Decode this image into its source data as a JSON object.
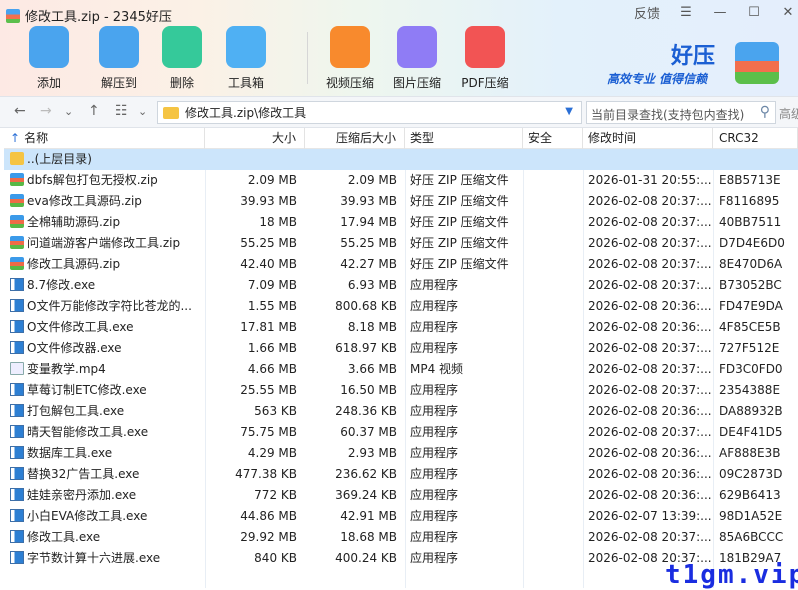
{
  "window": {
    "title": "修改工具.zip - 2345好压",
    "feedback": "反馈",
    "menu_icon": "menu-icon",
    "minimize_icon": "minimize-icon",
    "maximize_icon": "maximize-icon",
    "close_icon": "close-icon"
  },
  "toolbar": [
    {
      "label": "添加",
      "icon": "add-archive-icon",
      "color": "#4aa4ee"
    },
    {
      "label": "解压到",
      "icon": "extract-icon",
      "color": "#4aa4ee"
    },
    {
      "label": "删除",
      "icon": "recycle-icon",
      "color": "#35c99a"
    },
    {
      "label": "工具箱",
      "icon": "toolbox-icon",
      "color": "#4fb0f3"
    },
    {
      "label": "视频压缩",
      "icon": "video-compress-icon",
      "color": "#f88a2d"
    },
    {
      "label": "图片压缩",
      "icon": "image-compress-icon",
      "color": "#8f7cf5"
    },
    {
      "label": "PDF压缩",
      "icon": "pdf-compress-icon",
      "color": "#f25454"
    }
  ],
  "brand": {
    "name": "好压",
    "slogan": "高效专业 值得信赖"
  },
  "nav": {
    "path": "修改工具.zip\\修改工具",
    "search_placeholder": "当前目录查找(支持包内查找)",
    "advanced": "高级"
  },
  "columns": [
    "名称",
    "大小",
    "压缩后大小",
    "类型",
    "安全",
    "修改时间",
    "CRC32"
  ],
  "parent": "..(上层目录)",
  "files": [
    [
      "zip",
      "dbfs解包打包无授权.zip",
      "2.09 MB",
      "2.09 MB",
      "好压 ZIP 压缩文件",
      "",
      "2026-01-31 20:55:...",
      "E8B5713E"
    ],
    [
      "zip",
      "eva修改工具源码.zip",
      "39.93 MB",
      "39.93 MB",
      "好压 ZIP 压缩文件",
      "",
      "2026-02-08 20:37:...",
      "F8116895"
    ],
    [
      "zip",
      "全棉辅助源码.zip",
      "18 MB",
      "17.94 MB",
      "好压 ZIP 压缩文件",
      "",
      "2026-02-08 20:37:...",
      "40BB7511"
    ],
    [
      "zip",
      "问道端游客户端修改工具.zip",
      "55.25 MB",
      "55.25 MB",
      "好压 ZIP 压缩文件",
      "",
      "2026-02-08 20:37:...",
      "D7D4E6D0"
    ],
    [
      "zip",
      "修改工具源码.zip",
      "42.40 MB",
      "42.27 MB",
      "好压 ZIP 压缩文件",
      "",
      "2026-02-08 20:37:...",
      "8E470D6A"
    ],
    [
      "exe",
      "8.7修改.exe",
      "7.09 MB",
      "6.93 MB",
      "应用程序",
      "",
      "2026-02-08 20:37:...",
      "B73052BC"
    ],
    [
      "exe",
      "O文件万能修改字符比苍龙的...",
      "1.55 MB",
      "800.68 KB",
      "应用程序",
      "",
      "2026-02-08 20:36:...",
      "FD47E9DA"
    ],
    [
      "exe",
      "O文件修改工具.exe",
      "17.81 MB",
      "8.18 MB",
      "应用程序",
      "",
      "2026-02-08 20:36:...",
      "4F85CE5B"
    ],
    [
      "exe",
      "O文件修改器.exe",
      "1.66 MB",
      "618.97 KB",
      "应用程序",
      "",
      "2026-02-08 20:37:...",
      "727F512E"
    ],
    [
      "mp4",
      "变量教学.mp4",
      "4.66 MB",
      "3.66 MB",
      "MP4 视频",
      "",
      "2026-02-08 20:37:...",
      "FD3C0FD0"
    ],
    [
      "exe",
      "草莓订制ETC修改.exe",
      "25.55 MB",
      "16.50 MB",
      "应用程序",
      "",
      "2026-02-08 20:37:...",
      "2354388E"
    ],
    [
      "exe",
      "打包解包工具.exe",
      "563 KB",
      "248.36 KB",
      "应用程序",
      "",
      "2026-02-08 20:36:...",
      "DA88932B"
    ],
    [
      "exe",
      "晴天智能修改工具.exe",
      "75.75 MB",
      "60.37 MB",
      "应用程序",
      "",
      "2026-02-08 20:37:...",
      "DE4F41D5"
    ],
    [
      "exe",
      "数据库工具.exe",
      "4.29 MB",
      "2.93 MB",
      "应用程序",
      "",
      "2026-02-08 20:36:...",
      "AF888E3B"
    ],
    [
      "exe",
      "替换32广告工具.exe",
      "477.38 KB",
      "236.62 KB",
      "应用程序",
      "",
      "2026-02-08 20:36:...",
      "09C2873D"
    ],
    [
      "exe",
      "娃娃亲密丹添加.exe",
      "772 KB",
      "369.24 KB",
      "应用程序",
      "",
      "2026-02-08 20:36:...",
      "629B6413"
    ],
    [
      "exe",
      "小白EVA修改工具.exe",
      "44.86 MB",
      "42.91 MB",
      "应用程序",
      "",
      "2026-02-07 13:39:...",
      "98D1A52E"
    ],
    [
      "exe",
      "修改工具.exe",
      "29.92 MB",
      "18.68 MB",
      "应用程序",
      "",
      "2026-02-08 20:37:...",
      "85A6BCCC"
    ],
    [
      "exe",
      "字节数计算十六进展.exe",
      "840 KB",
      "400.24 KB",
      "应用程序",
      "",
      "2026-02-08 20:37:...",
      "181B29A7"
    ]
  ],
  "watermark": "t1gm.vip"
}
